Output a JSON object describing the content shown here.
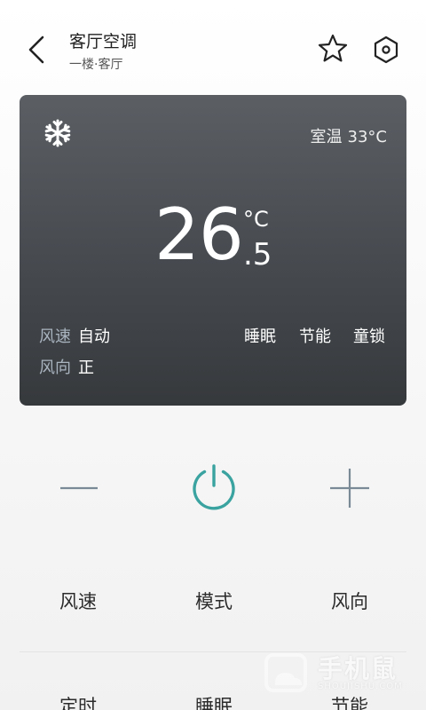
{
  "header": {
    "title": "客厅空调",
    "subtitle": "一楼·客厅"
  },
  "status_card": {
    "mode_icon": "snowflake-icon",
    "room_temp_label": "室温",
    "room_temp_value": "33°C",
    "set_temp_integer": "26",
    "set_temp_unit": "°C",
    "set_temp_decimal": ".5",
    "fan_speed_label": "风速",
    "fan_speed_value": "自动",
    "fan_direction_label": "风向",
    "fan_direction_value": "正",
    "features": [
      "睡眠",
      "节能",
      "童锁"
    ]
  },
  "controls": {
    "accent_color": "#3aa3a0",
    "icon_color": "#7a8a96"
  },
  "functions": {
    "row1": [
      "风速",
      "模式",
      "风向"
    ],
    "row2": [
      "定时",
      "睡眠",
      "节能"
    ]
  },
  "watermark": {
    "text": "手机鼠",
    "subtext": "SHOUJISHU.COM"
  }
}
